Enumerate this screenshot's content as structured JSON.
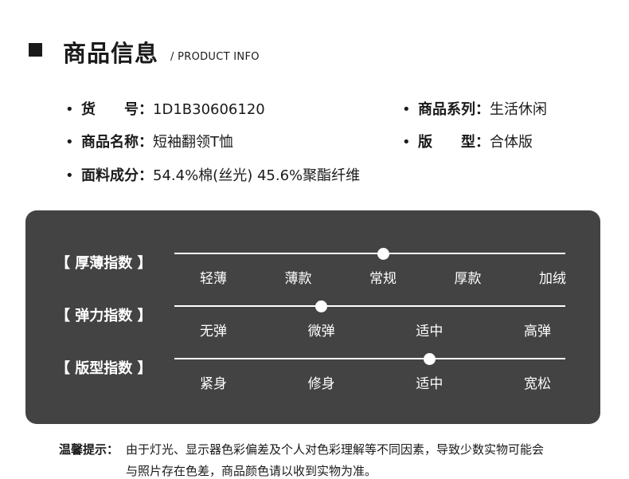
{
  "header": {
    "title_cn": "商品信息",
    "title_en": "/ PRODUCT INFO"
  },
  "info": {
    "bullet": "•",
    "item_no": {
      "label": "货　　号：",
      "value": "1D1B30606120"
    },
    "series": {
      "label": "商品系列：",
      "value": "生活休闲"
    },
    "name": {
      "label": "商品名称：",
      "value": "短袖翻领T恤"
    },
    "fit_type": {
      "label": "版　　型：",
      "value": "合体版"
    },
    "fabric": {
      "label": "面料成分：",
      "value": "54.4%棉(丝光) 45.6%聚酯纤维"
    }
  },
  "indices": [
    {
      "title": "【 厚薄指数 】",
      "ticks": [
        "轻薄",
        "薄款",
        "常规",
        "厚款",
        "加绒"
      ],
      "selected_index": 2
    },
    {
      "title": "【 弹力指数 】",
      "ticks": [
        "无弹",
        "微弹",
        "适中",
        "高弹"
      ],
      "selected_index": 1
    },
    {
      "title": "【 版型指数 】",
      "ticks": [
        "紧身",
        "修身",
        "适中",
        "宽松"
      ],
      "selected_index": 2
    }
  ],
  "tip": {
    "label": "温馨提示：",
    "line1": "由于灯光、显示器色彩偏差及个人对色彩理解等不同因素，导致少数实物可能会",
    "line2": "与照片存在色差，商品颜色请以收到实物为准。"
  }
}
